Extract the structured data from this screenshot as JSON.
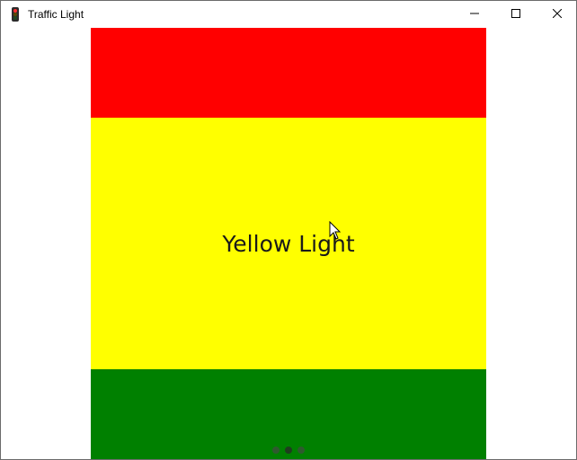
{
  "window": {
    "title": "Traffic Light",
    "icon": "traffic-light-icon",
    "controls": [
      "minimize-icon",
      "maximize-icon",
      "close-icon"
    ]
  },
  "lights": {
    "red": {
      "color": "#ff0000",
      "label": ""
    },
    "yellow": {
      "color": "#ffff00",
      "label": "Yellow Light"
    },
    "green": {
      "color": "#008000",
      "label": ""
    }
  },
  "pager": {
    "total": 3,
    "active_index": 1
  }
}
